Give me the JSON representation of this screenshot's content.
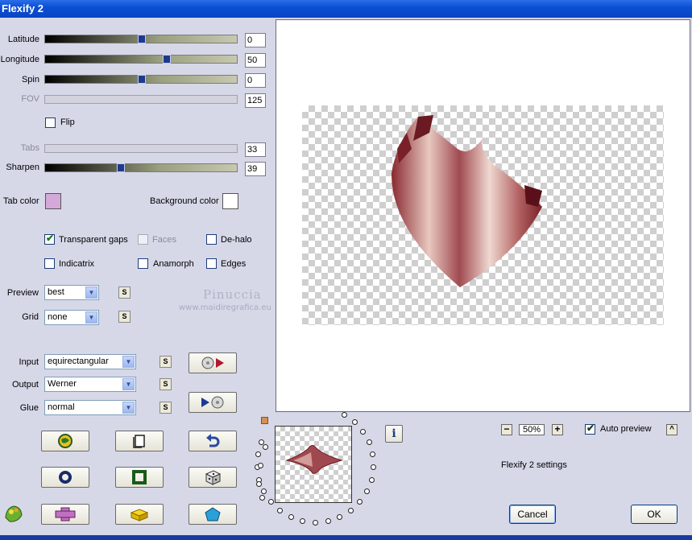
{
  "window": {
    "title": "Flexify 2"
  },
  "sliders": {
    "latitude": {
      "label": "Latitude",
      "value": "0",
      "fraction": 0.5,
      "enabled": true
    },
    "longitude": {
      "label": "Longitude",
      "value": "50",
      "fraction": 0.63,
      "enabled": true
    },
    "spin": {
      "label": "Spin",
      "value": "0",
      "fraction": 0.5,
      "enabled": true
    },
    "fov": {
      "label": "FOV",
      "value": "125",
      "fraction": 0.0,
      "enabled": false
    },
    "tabs": {
      "label": "Tabs",
      "value": "33",
      "fraction": 0.0,
      "enabled": false
    },
    "sharpen": {
      "label": "Sharpen",
      "value": "39",
      "fraction": 0.39,
      "enabled": true
    }
  },
  "flip": {
    "label": "Flip",
    "checked": false
  },
  "colors": {
    "tab_color_label": "Tab color",
    "tab_color": "#d4a8d8",
    "background_color_label": "Background color",
    "background_color": "#ffffff"
  },
  "options": {
    "transparent_gaps": {
      "label": "Transparent gaps",
      "checked": true
    },
    "faces": {
      "label": "Faces",
      "checked": false,
      "enabled": false
    },
    "de_halo": {
      "label": "De-halo",
      "checked": false
    },
    "indicatrix": {
      "label": "Indicatrix",
      "checked": false
    },
    "anamorph": {
      "label": "Anamorph",
      "checked": false
    },
    "edges": {
      "label": "Edges",
      "checked": false
    }
  },
  "selects": {
    "preview": {
      "label": "Preview",
      "value": "best"
    },
    "grid": {
      "label": "Grid",
      "value": "none"
    },
    "input": {
      "label": "Input",
      "value": "equirectangular"
    },
    "output": {
      "label": "Output",
      "value": "Werner"
    },
    "glue": {
      "label": "Glue",
      "value": "normal"
    }
  },
  "small_button_label": "S",
  "watermark": {
    "name": "Pinuccia",
    "site": "www.maidiregrafica.eu"
  },
  "zoom": {
    "value": "50%",
    "minus": "−",
    "plus": "+"
  },
  "auto_preview": {
    "label": "Auto preview",
    "checked": true
  },
  "caret_label": "^",
  "status_text": "Flexify 2 settings",
  "info_label": "i",
  "buttons": {
    "cancel": "Cancel",
    "ok": "OK"
  },
  "accent_colors": {
    "shape_dark": "#6a1a22",
    "shape_mid": "#b36a6a",
    "shape_light": "#f0d0c8"
  }
}
